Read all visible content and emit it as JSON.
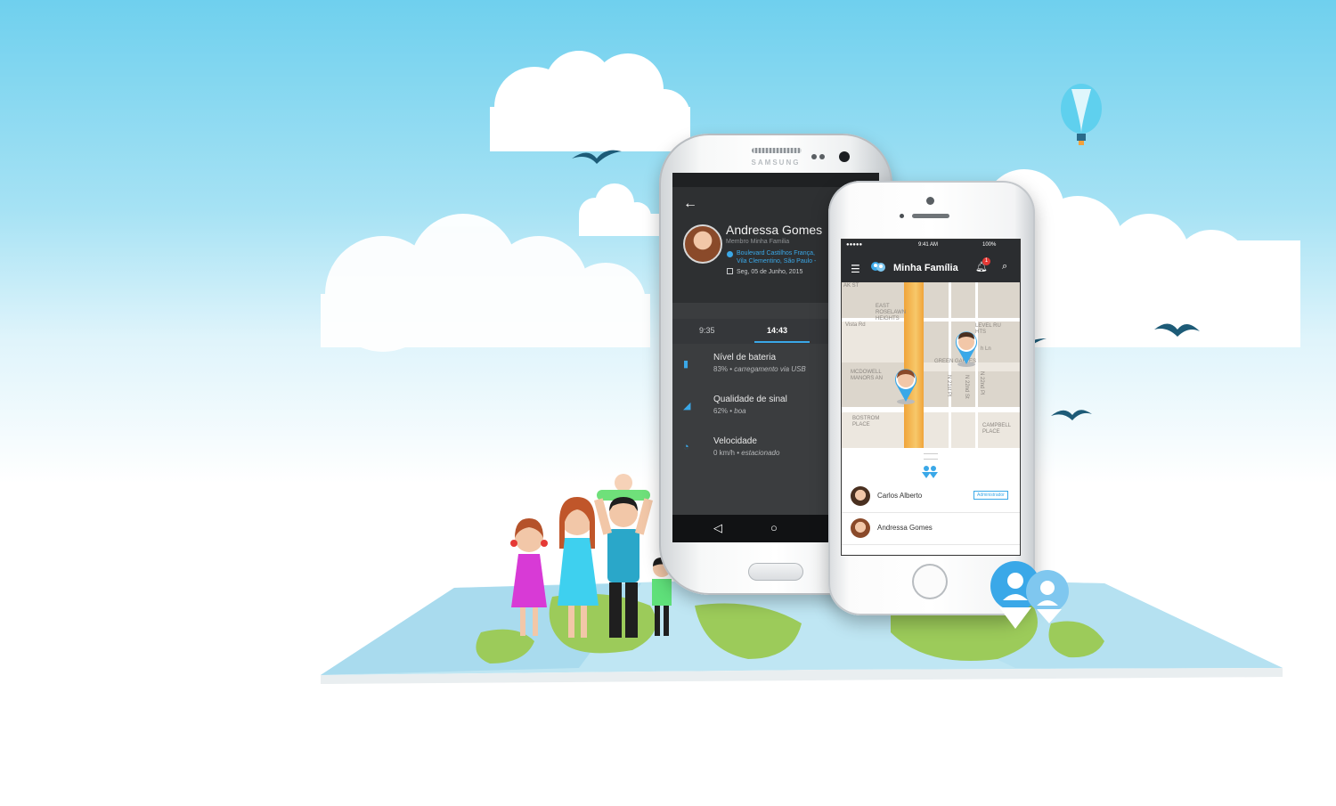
{
  "android": {
    "brand": "SAMSUNG",
    "profile_name": "Andressa Gomes",
    "profile_role": "Membro Minha Familia",
    "address_line1": "Boulevard Castilhos França,",
    "address_line2": "Vila Clementino, São Paulo -",
    "date": "Seg, 05 de Junho, 2015",
    "tabs": [
      {
        "label": "9:35",
        "selected": false
      },
      {
        "label": "14:43",
        "selected": true
      }
    ],
    "items": [
      {
        "icon": "battery-icon",
        "title": "Nível de bateria",
        "value": "83%",
        "detail": "carregamento via USB"
      },
      {
        "icon": "signal-icon",
        "title": "Qualidade de sinal",
        "value": "62%",
        "detail": "boa"
      },
      {
        "icon": "speedometer-icon",
        "title": "Velocidade",
        "value": "0 km/h",
        "detail": "estacionado"
      }
    ],
    "nav": {
      "back": "◁",
      "home": "○"
    }
  },
  "iphone": {
    "status": {
      "signal": "●●●●● ",
      "time": "9:41 AM",
      "battery": "100%"
    },
    "app_title": "Minha Família",
    "notification_count": "1",
    "map_labels": {
      "east_roselawn": "EAST ROSELAWN HEIGHTS",
      "vista": "Vista Rd",
      "level_ru": "LEVEL RU HTS",
      "green_gables": "GREEN GABLES",
      "mcdowell": "MCDOWELL MANORS AN",
      "bostrom": "BOSTROM PLACE",
      "campbell": "CAMPBELL PLACE",
      "st": "ak St",
      "n21": "N 21st Pl",
      "n22st": "N 22nd St",
      "n22pl": "N 22nd Pl",
      "ln": "h Ln"
    },
    "members": [
      {
        "name": "Carlos Alberto",
        "tag": "Administrador"
      },
      {
        "name": "Andressa Gomes",
        "tag": ""
      }
    ]
  },
  "colors": {
    "accent": "#3aa8e8",
    "sky": "#6fd0ee",
    "dark": "#2b2d30"
  }
}
